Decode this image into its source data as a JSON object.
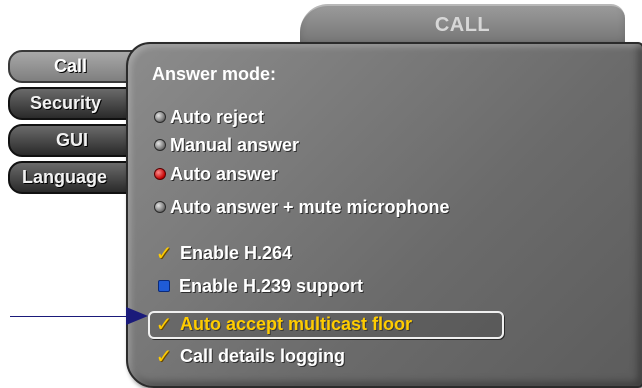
{
  "header": {
    "title": "CALL"
  },
  "sidebar": {
    "tabs": [
      {
        "label": "Call",
        "active": true
      },
      {
        "label": "Security",
        "active": false
      },
      {
        "label": "GUI",
        "active": false
      },
      {
        "label": "Language",
        "active": false
      }
    ]
  },
  "panel": {
    "answer_mode_label": "Answer mode:",
    "answer_modes": [
      {
        "label": "Auto reject",
        "selected": false
      },
      {
        "label": "Manual answer",
        "selected": false
      },
      {
        "label": "Auto answer",
        "selected": true
      },
      {
        "label": "Auto answer + mute microphone",
        "selected": false
      }
    ],
    "options": [
      {
        "label": "Enable H.264",
        "checked": true,
        "focused": false
      },
      {
        "label": "Enable H.239 support",
        "checked": false,
        "focused": false
      },
      {
        "label": "Auto accept multicast floor",
        "checked": true,
        "focused": true
      },
      {
        "label": "Call details logging",
        "checked": true,
        "focused": false
      }
    ]
  },
  "icons": {
    "checkmark": "✓",
    "radio_selected_color": "#c30000",
    "check_color": "#ffcc00",
    "box_color": "#1f5bd6",
    "arrow_color": "#1a1a7a"
  }
}
